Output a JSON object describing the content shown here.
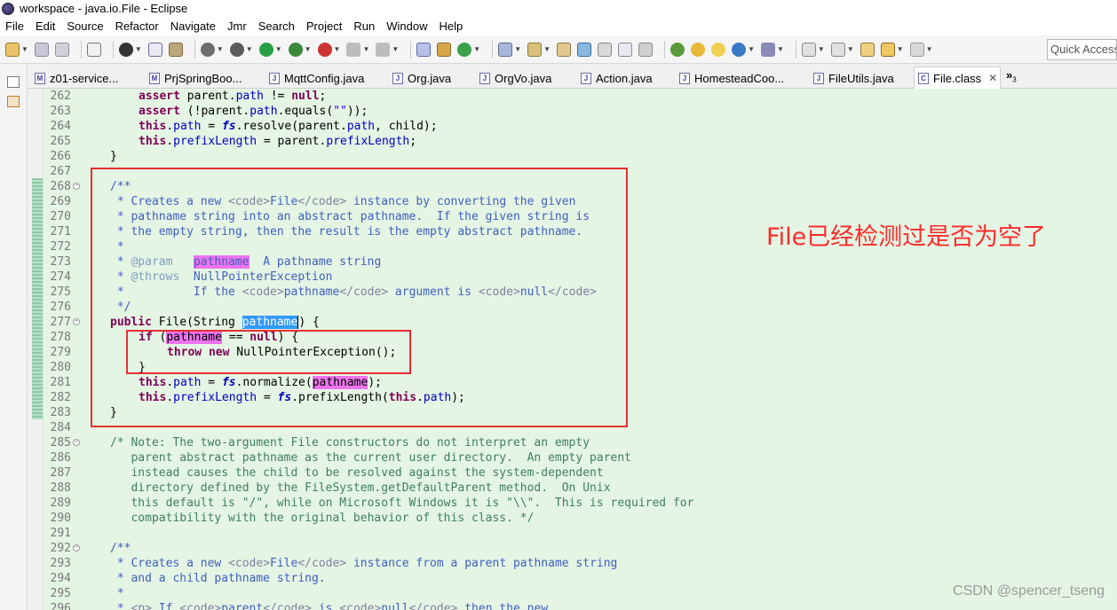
{
  "window": {
    "title": "workspace - java.io.File - Eclipse"
  },
  "menu": [
    {
      "label": "File"
    },
    {
      "label": "Edit"
    },
    {
      "label": "Source"
    },
    {
      "label": "Refactor"
    },
    {
      "label": "Navigate"
    },
    {
      "label": "Jmr"
    },
    {
      "label": "Search"
    },
    {
      "label": "Project"
    },
    {
      "label": "Run"
    },
    {
      "label": "Window"
    },
    {
      "label": "Help"
    }
  ],
  "toolbar": {
    "quick_access_placeholder": "Quick Access"
  },
  "tabs": [
    {
      "label": "z01-service...",
      "active": false
    },
    {
      "label": "PrjSpringBoo...",
      "active": false
    },
    {
      "label": "MqttConfig.java",
      "active": false
    },
    {
      "label": "Org.java",
      "active": false
    },
    {
      "label": "OrgVo.java",
      "active": false
    },
    {
      "label": "Action.java",
      "active": false
    },
    {
      "label": "HomesteadCoo...",
      "active": false
    },
    {
      "label": "FileUtils.java",
      "active": false
    },
    {
      "label": "File.class",
      "active": true
    }
  ],
  "tab_overflow": {
    "symbol": "»",
    "count": "3"
  },
  "editor": {
    "line_numbers": [
      "262",
      "263",
      "264",
      "265",
      "266",
      "267",
      "268",
      "269",
      "270",
      "271",
      "272",
      "273",
      "274",
      "275",
      "276",
      "277",
      "278",
      "279",
      "280",
      "281",
      "282",
      "283",
      "284",
      "285",
      "286",
      "287",
      "288",
      "289",
      "290",
      "291",
      "292",
      "293",
      "294",
      "295",
      "296"
    ]
  },
  "annotation": {
    "text": "File已经检测过是否为空了"
  },
  "watermark": {
    "text": "CSDN @spencer_tseng"
  }
}
